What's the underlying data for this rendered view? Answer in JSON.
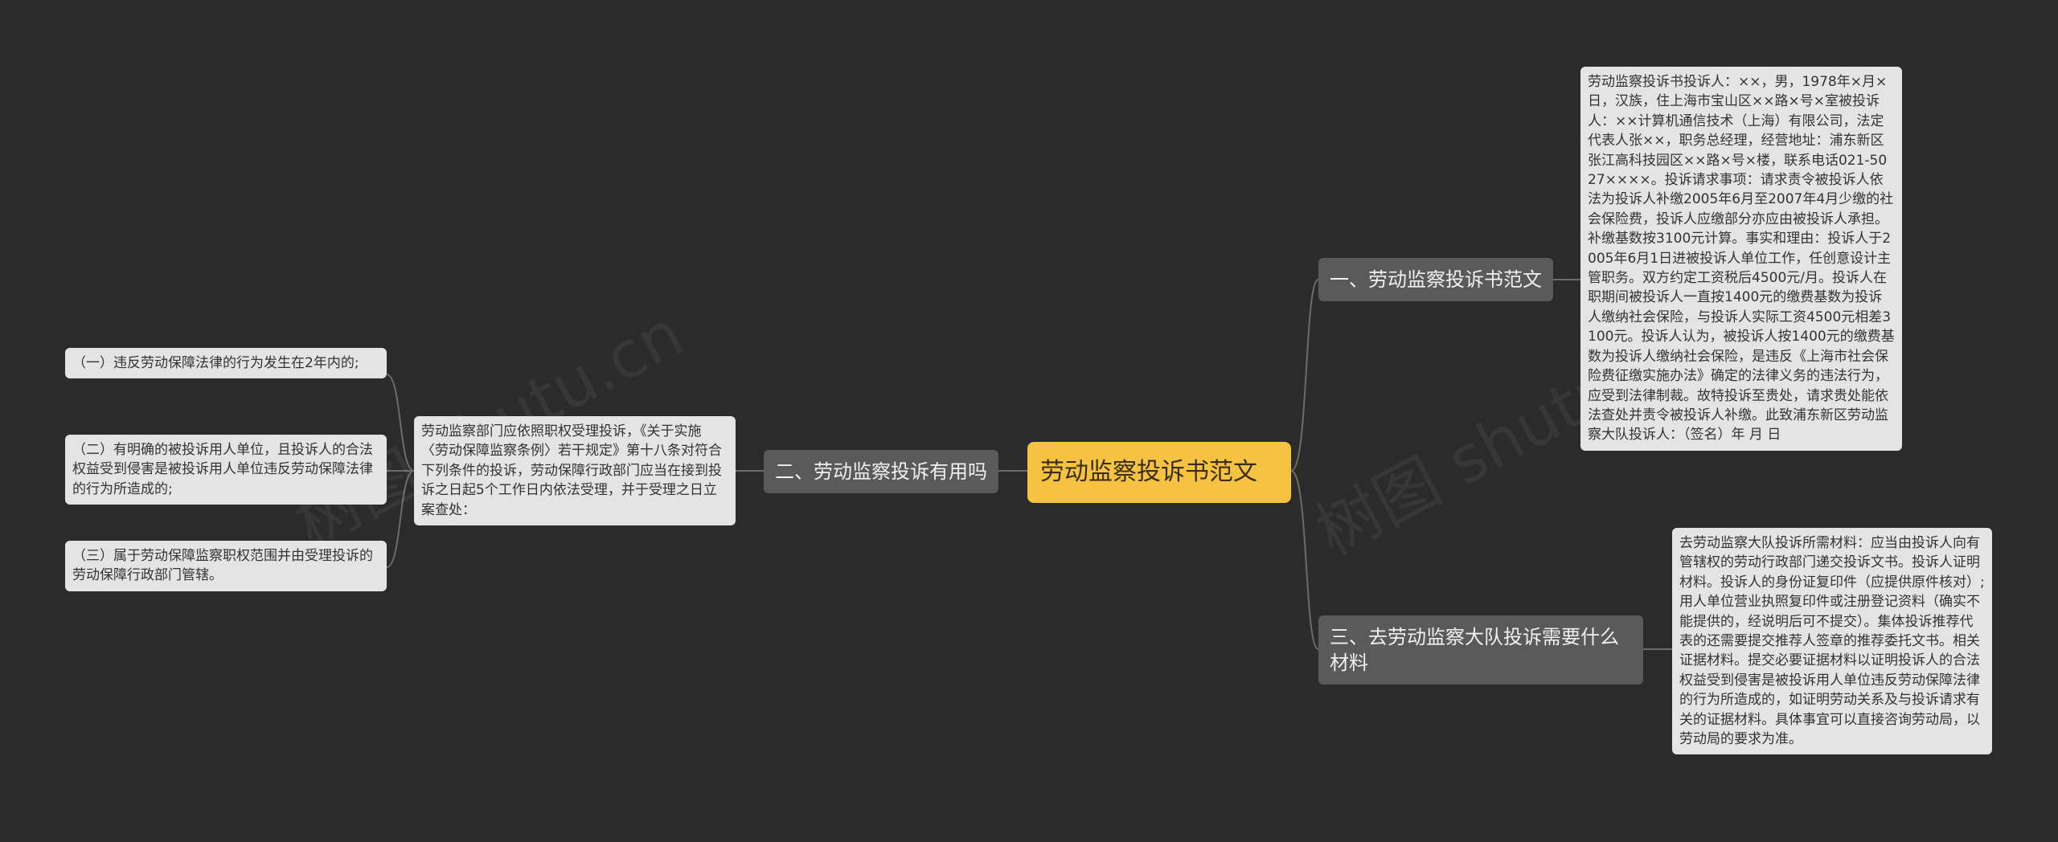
{
  "root": {
    "label": "劳动监察投诉书范文"
  },
  "branches": {
    "b1": {
      "label": "一、劳动监察投诉书范文"
    },
    "b2": {
      "label": "二、劳动监察投诉有用吗"
    },
    "b3": {
      "label": "三、去劳动监察大队投诉需要什么材料"
    }
  },
  "leaves": {
    "l1": "劳动监察投诉书投诉人：××，男，1978年×月×日，汉族，住上海市宝山区××路×号×室被投诉人：××计算机通信技术（上海）有限公司，法定代表人张××，职务总经理，经营地址：浦东新区张江高科技园区××路×号×楼，联系电话021-5027××××。投诉请求事项：请求责令被投诉人依法为投诉人补缴2005年6月至2007年4月少缴的社会保险费，投诉人应缴部分亦应由被投诉人承担。补缴基数按3100元计算。事实和理由：投诉人于2005年6月1日进被投诉人单位工作，任创意设计主管职务。双方约定工资税后4500元/月。投诉人在职期间被投诉人一直按1400元的缴费基数为投诉人缴纳社会保险，与投诉人实际工资4500元相差3100元。投诉人认为，被投诉人按1400元的缴费基数为投诉人缴纳社会保险，是违反《上海市社会保险费征缴实施办法》确定的法律义务的违法行为，应受到法律制裁。故特投诉至贵处，请求贵处能依法查处并责令被投诉人补缴。此致浦东新区劳动监察大队投诉人：（签名）年 月 日",
    "l2": "劳动监察部门应依照职权受理投诉，《关于实施〈劳动保障监察条例〉若干规定》第十八条对符合下列条件的投诉，劳动保障行政部门应当在接到投诉之日起5个工作日内依法受理，并于受理之日立案查处：",
    "l3": "去劳动监察大队投诉所需材料：应当由投诉人向有管辖权的劳动行政部门递交投诉文书。投诉人证明材料。投诉人的身份证复印件（应提供原件核对）;用人单位营业执照复印件或注册登记资料（确实不能提供的，经说明后可不提交）。集体投诉推荐代表的还需要提交推荐人签章的推荐委托文书。相关证据材料。提交必要证据材料以证明投诉人的合法权益受到侵害是被投诉用人单位违反劳动保障法律的行为所造成的，如证明劳动关系及与投诉请求有关的证据材料。具体事宜可以直接咨询劳动局，以劳动局的要求为准。",
    "c1": "（一）违反劳动保障法律的行为发生在2年内的;",
    "c2": "（二）有明确的被投诉用人单位，且投诉人的合法权益受到侵害是被投诉用人单位违反劳动保障法律的行为所造成的;",
    "c3": "（三）属于劳动保障监察职权范围并由受理投诉的劳动保障行政部门管辖。"
  },
  "watermarks": [
    "树图 shutu.cn",
    "树图 shutu.cn"
  ],
  "colors": {
    "background": "#2b2b2b",
    "root": "#f5c242",
    "branch": "#5a5a5a",
    "leaf": "#e4e4e4",
    "line": "#6b6b6b"
  }
}
